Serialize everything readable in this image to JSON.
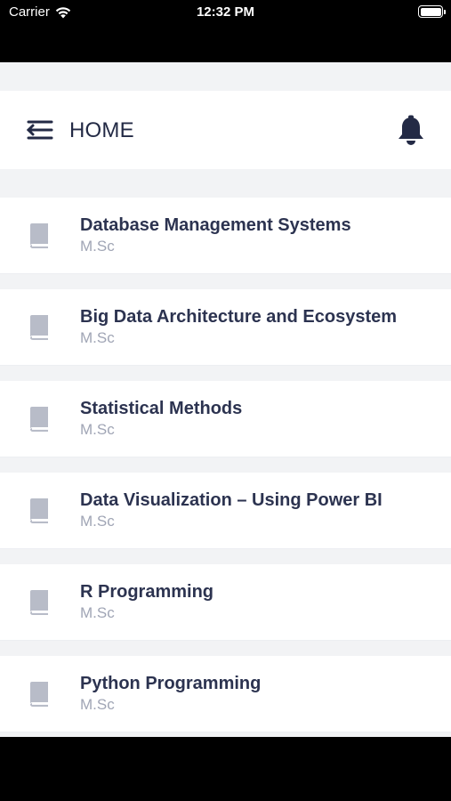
{
  "status_bar": {
    "carrier": "Carrier",
    "time": "12:32 PM",
    "battery_level": 1.0
  },
  "header": {
    "title": "HOME",
    "menu_icon": "menu-collapse-icon",
    "notification_icon": "bell-icon"
  },
  "colors": {
    "title_text": "#232a45",
    "subtitle_text": "#a0a5b5",
    "icon_gray": "#b8bcc8",
    "background": "#f2f3f5"
  },
  "courses": [
    {
      "title": "Database Management Systems",
      "subtitle": "M.Sc",
      "icon": "book-icon"
    },
    {
      "title": "Big Data Architecture and Ecosystem",
      "subtitle": "M.Sc",
      "icon": "book-icon"
    },
    {
      "title": "Statistical Methods",
      "subtitle": "M.Sc",
      "icon": "book-icon"
    },
    {
      "title": "Data Visualization – Using Power BI",
      "subtitle": "M.Sc",
      "icon": "book-icon"
    },
    {
      "title": "R Programming",
      "subtitle": "M.Sc",
      "icon": "book-icon"
    },
    {
      "title": "Python Programming",
      "subtitle": "M.Sc",
      "icon": "book-icon"
    }
  ]
}
